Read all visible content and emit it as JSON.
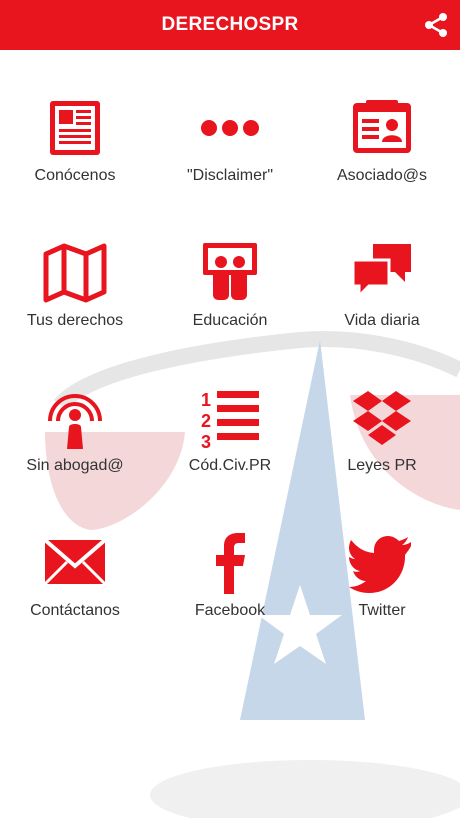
{
  "header": {
    "title": "DERECHOSPR",
    "share_icon": "share-icon"
  },
  "colors": {
    "brand": "#e8141e",
    "text": "#333333"
  },
  "menu": [
    {
      "label": "Conócenos",
      "icon": "newspaper-icon"
    },
    {
      "label": "\"Disclaimer\"",
      "icon": "ellipsis-icon"
    },
    {
      "label": "Asociado@s",
      "icon": "id-card-icon"
    },
    {
      "label": "Tus derechos",
      "icon": "map-icon"
    },
    {
      "label": "Educación",
      "icon": "presentation-icon"
    },
    {
      "label": "Vida diaria",
      "icon": "chat-bubbles-icon"
    },
    {
      "label": "Sin abogad@",
      "icon": "podcast-icon"
    },
    {
      "label": "Cód.Civ.PR",
      "icon": "numbered-list-icon"
    },
    {
      "label": "Leyes PR",
      "icon": "dropbox-icon"
    },
    {
      "label": "Contáctanos",
      "icon": "envelope-icon"
    },
    {
      "label": "Facebook",
      "icon": "facebook-icon"
    },
    {
      "label": "Twitter",
      "icon": "twitter-icon"
    }
  ]
}
